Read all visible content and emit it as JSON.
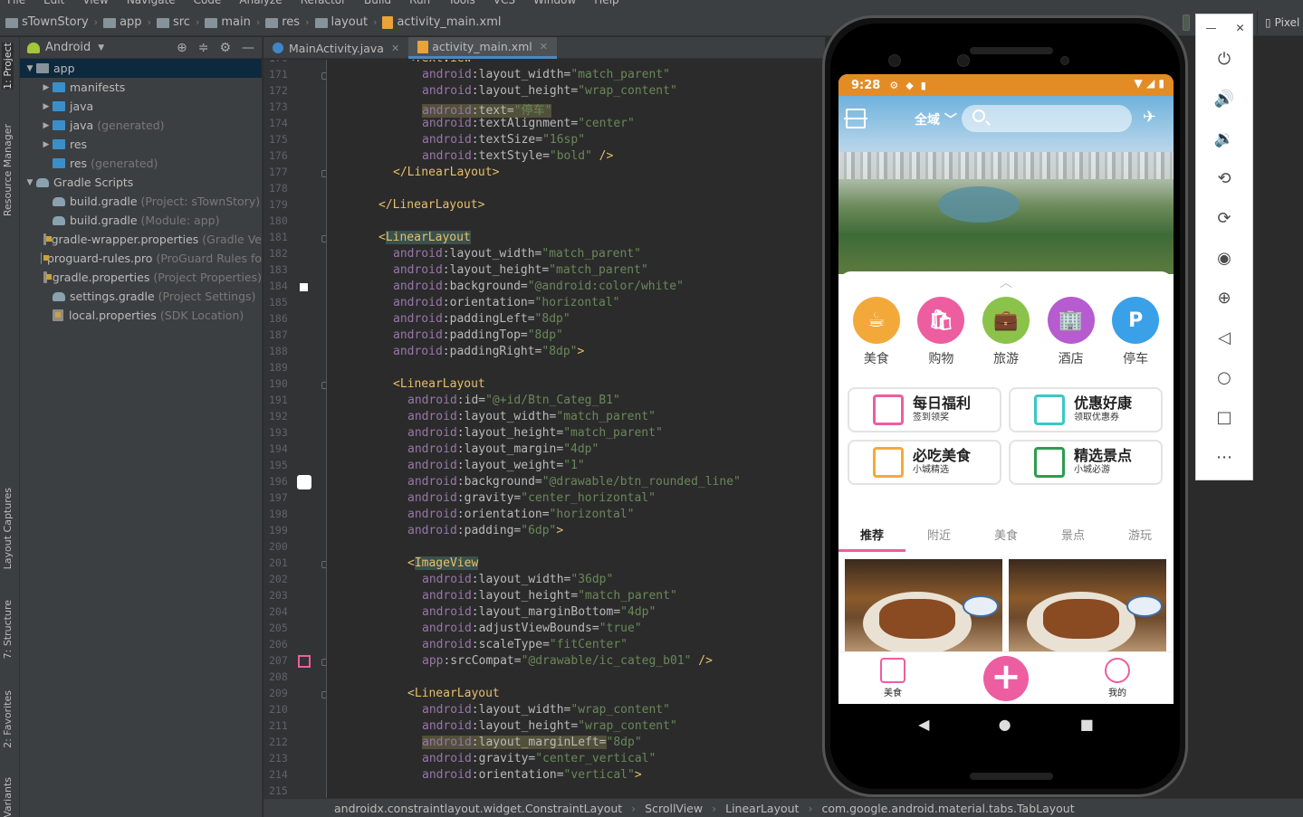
{
  "menu": [
    "File",
    "Edit",
    "View",
    "Navigate",
    "Code",
    "Analyze",
    "Refactor",
    "Build",
    "Run",
    "Tools",
    "VCS",
    "Window",
    "Help"
  ],
  "breadcrumbs": [
    "sTownStory",
    "app",
    "src",
    "main",
    "res",
    "layout",
    "activity_main.xml"
  ],
  "side_tabs": {
    "project": "1: Project",
    "resource_manager": "Resource Manager",
    "layout_captures": "Layout Captures",
    "structure": "7: Structure",
    "favorites": "2: Favorites",
    "variants": "Variants"
  },
  "project_panel": {
    "view_mode": "Android",
    "tree": [
      {
        "label": "app",
        "meta": "",
        "depth": 0,
        "expanded": true,
        "icon": "folder-module-icon",
        "selected": true
      },
      {
        "label": "manifests",
        "meta": "",
        "depth": 1,
        "expanded": false,
        "icon": "folder-icon"
      },
      {
        "label": "java",
        "meta": "",
        "depth": 1,
        "expanded": false,
        "icon": "folder-icon"
      },
      {
        "label": "java",
        "meta": "(generated)",
        "depth": 1,
        "expanded": false,
        "icon": "folder-icon"
      },
      {
        "label": "res",
        "meta": "",
        "depth": 1,
        "expanded": false,
        "icon": "folder-icon"
      },
      {
        "label": "res",
        "meta": "(generated)",
        "depth": 1,
        "expanded": null,
        "icon": "folder-icon"
      },
      {
        "label": "Gradle Scripts",
        "meta": "",
        "depth": 0,
        "expanded": true,
        "icon": "gradle-icon"
      },
      {
        "label": "build.gradle",
        "meta": "(Project: sTownStory)",
        "depth": 1,
        "icon": "gradle-icon"
      },
      {
        "label": "build.gradle",
        "meta": "(Module: app)",
        "depth": 1,
        "icon": "gradle-icon"
      },
      {
        "label": "gradle-wrapper.properties",
        "meta": "(Gradle Ve",
        "depth": 1,
        "icon": "properties-icon"
      },
      {
        "label": "proguard-rules.pro",
        "meta": "(ProGuard Rules fo",
        "depth": 1,
        "icon": "properties-icon"
      },
      {
        "label": "gradle.properties",
        "meta": "(Project Properties)",
        "depth": 1,
        "icon": "properties-icon"
      },
      {
        "label": "settings.gradle",
        "meta": "(Project Settings)",
        "depth": 1,
        "icon": "gradle-icon"
      },
      {
        "label": "local.properties",
        "meta": "(SDK Location)",
        "depth": 1,
        "icon": "properties-icon"
      }
    ]
  },
  "editor_tabs": [
    {
      "label": "MainActivity.java",
      "active": false
    },
    {
      "label": "activity_main.xml",
      "active": true
    }
  ],
  "code": {
    "first_line": 170,
    "lines": [
      {
        "n": 170,
        "indent": 10,
        "tokens": [
          [
            "tg",
            "<TextView"
          ]
        ]
      },
      {
        "n": 171,
        "indent": 12,
        "tokens": [
          [
            "ns",
            "android"
          ],
          [
            "at",
            ":layout_width="
          ],
          [
            "vl",
            "\"match_parent\""
          ]
        ]
      },
      {
        "n": 172,
        "indent": 12,
        "tokens": [
          [
            "ns",
            "android"
          ],
          [
            "at",
            ":layout_height="
          ],
          [
            "vl",
            "\"wrap_content\""
          ]
        ]
      },
      {
        "n": 173,
        "indent": 12,
        "tokens": [
          [
            "hla ns",
            "android"
          ],
          [
            "hla at",
            ":text="
          ],
          [
            "hla vl",
            "\"停车\""
          ]
        ]
      },
      {
        "n": 174,
        "indent": 12,
        "tokens": [
          [
            "ns",
            "android"
          ],
          [
            "at",
            ":textAlignment="
          ],
          [
            "vl",
            "\"center\""
          ]
        ]
      },
      {
        "n": 175,
        "indent": 12,
        "tokens": [
          [
            "ns",
            "android"
          ],
          [
            "at",
            ":textSize="
          ],
          [
            "vl",
            "\"16sp\""
          ]
        ]
      },
      {
        "n": 176,
        "indent": 12,
        "tokens": [
          [
            "ns",
            "android"
          ],
          [
            "at",
            ":textStyle="
          ],
          [
            "vl",
            "\"bold\""
          ],
          [
            "tg",
            " />"
          ]
        ]
      },
      {
        "n": 177,
        "indent": 8,
        "tokens": [
          [
            "tg",
            "</LinearLayout>"
          ]
        ]
      },
      {
        "n": 178,
        "indent": 0,
        "tokens": []
      },
      {
        "n": 179,
        "indent": 6,
        "tokens": [
          [
            "tg",
            "</LinearLayout>"
          ]
        ]
      },
      {
        "n": 180,
        "indent": 0,
        "tokens": []
      },
      {
        "n": 181,
        "indent": 6,
        "tokens": [
          [
            "tg",
            "<"
          ],
          [
            "hl tg",
            "LinearLayout"
          ]
        ]
      },
      {
        "n": 182,
        "indent": 8,
        "tokens": [
          [
            "ns",
            "android"
          ],
          [
            "at",
            ":layout_width="
          ],
          [
            "vl",
            "\"match_parent\""
          ]
        ]
      },
      {
        "n": 183,
        "indent": 8,
        "tokens": [
          [
            "ns",
            "android"
          ],
          [
            "at",
            ":layout_height="
          ],
          [
            "vl",
            "\"match_parent\""
          ]
        ]
      },
      {
        "n": 184,
        "indent": 8,
        "tokens": [
          [
            "ns",
            "android"
          ],
          [
            "at",
            ":background="
          ],
          [
            "vl",
            "\"@android:color/white\""
          ]
        ]
      },
      {
        "n": 185,
        "indent": 8,
        "tokens": [
          [
            "ns",
            "android"
          ],
          [
            "at",
            ":orientation="
          ],
          [
            "vl",
            "\"horizontal\""
          ]
        ]
      },
      {
        "n": 186,
        "indent": 8,
        "tokens": [
          [
            "ns",
            "android"
          ],
          [
            "at",
            ":paddingLeft="
          ],
          [
            "vl",
            "\"8dp\""
          ]
        ]
      },
      {
        "n": 187,
        "indent": 8,
        "tokens": [
          [
            "ns",
            "android"
          ],
          [
            "at",
            ":paddingTop="
          ],
          [
            "vl",
            "\"8dp\""
          ]
        ]
      },
      {
        "n": 188,
        "indent": 8,
        "tokens": [
          [
            "ns",
            "android"
          ],
          [
            "at",
            ":paddingRight="
          ],
          [
            "vl",
            "\"8dp\""
          ],
          [
            "tg",
            ">"
          ]
        ]
      },
      {
        "n": 189,
        "indent": 0,
        "tokens": []
      },
      {
        "n": 190,
        "indent": 8,
        "tokens": [
          [
            "tg",
            "<LinearLayout"
          ]
        ]
      },
      {
        "n": 191,
        "indent": 10,
        "tokens": [
          [
            "ns",
            "android"
          ],
          [
            "at",
            ":id="
          ],
          [
            "vl",
            "\"@+id/Btn_Categ_B1\""
          ]
        ]
      },
      {
        "n": 192,
        "indent": 10,
        "tokens": [
          [
            "ns",
            "android"
          ],
          [
            "at",
            ":layout_width="
          ],
          [
            "vl",
            "\"match_parent\""
          ]
        ]
      },
      {
        "n": 193,
        "indent": 10,
        "tokens": [
          [
            "ns",
            "android"
          ],
          [
            "at",
            ":layout_height="
          ],
          [
            "vl",
            "\"match_parent\""
          ]
        ]
      },
      {
        "n": 194,
        "indent": 10,
        "tokens": [
          [
            "ns",
            "android"
          ],
          [
            "at",
            ":layout_margin="
          ],
          [
            "vl",
            "\"4dp\""
          ]
        ]
      },
      {
        "n": 195,
        "indent": 10,
        "tokens": [
          [
            "ns",
            "android"
          ],
          [
            "at",
            ":layout_weight="
          ],
          [
            "vl",
            "\"1\""
          ]
        ]
      },
      {
        "n": 196,
        "indent": 10,
        "tokens": [
          [
            "ns",
            "android"
          ],
          [
            "at",
            ":background="
          ],
          [
            "vl",
            "\"@drawable/btn_rounded_line\""
          ]
        ]
      },
      {
        "n": 197,
        "indent": 10,
        "tokens": [
          [
            "ns",
            "android"
          ],
          [
            "at",
            ":gravity="
          ],
          [
            "vl",
            "\"center_horizontal\""
          ]
        ]
      },
      {
        "n": 198,
        "indent": 10,
        "tokens": [
          [
            "ns",
            "android"
          ],
          [
            "at",
            ":orientation="
          ],
          [
            "vl",
            "\"horizontal\""
          ]
        ]
      },
      {
        "n": 199,
        "indent": 10,
        "tokens": [
          [
            "ns",
            "android"
          ],
          [
            "at",
            ":padding="
          ],
          [
            "vl",
            "\"6dp\""
          ],
          [
            "tg",
            ">"
          ]
        ]
      },
      {
        "n": 200,
        "indent": 0,
        "tokens": []
      },
      {
        "n": 201,
        "indent": 10,
        "tokens": [
          [
            "tg",
            "<"
          ],
          [
            "hl tg",
            "ImageView"
          ]
        ]
      },
      {
        "n": 202,
        "indent": 12,
        "tokens": [
          [
            "ns",
            "android"
          ],
          [
            "at",
            ":layout_width="
          ],
          [
            "vl",
            "\"36dp\""
          ]
        ]
      },
      {
        "n": 203,
        "indent": 12,
        "tokens": [
          [
            "ns",
            "android"
          ],
          [
            "at",
            ":layout_height="
          ],
          [
            "vl",
            "\"match_parent\""
          ]
        ]
      },
      {
        "n": 204,
        "indent": 12,
        "tokens": [
          [
            "ns",
            "android"
          ],
          [
            "at",
            ":layout_marginBottom="
          ],
          [
            "vl",
            "\"4dp\""
          ]
        ]
      },
      {
        "n": 205,
        "indent": 12,
        "tokens": [
          [
            "ns",
            "android"
          ],
          [
            "at",
            ":adjustViewBounds="
          ],
          [
            "vl",
            "\"true\""
          ]
        ]
      },
      {
        "n": 206,
        "indent": 12,
        "tokens": [
          [
            "ns",
            "android"
          ],
          [
            "at",
            ":scaleType="
          ],
          [
            "vl",
            "\"fitCenter\""
          ]
        ]
      },
      {
        "n": 207,
        "indent": 12,
        "tokens": [
          [
            "ns",
            "app"
          ],
          [
            "at",
            ":srcCompat="
          ],
          [
            "vl",
            "\"@drawable/ic_categ_b01\""
          ],
          [
            "tg",
            " />"
          ]
        ]
      },
      {
        "n": 208,
        "indent": 0,
        "tokens": []
      },
      {
        "n": 209,
        "indent": 10,
        "tokens": [
          [
            "tg",
            "<LinearLayout"
          ]
        ]
      },
      {
        "n": 210,
        "indent": 12,
        "tokens": [
          [
            "ns",
            "android"
          ],
          [
            "at",
            ":layout_width="
          ],
          [
            "vl",
            "\"wrap_content\""
          ]
        ]
      },
      {
        "n": 211,
        "indent": 12,
        "tokens": [
          [
            "ns",
            "android"
          ],
          [
            "at",
            ":layout_height="
          ],
          [
            "vl",
            "\"wrap_content\""
          ]
        ]
      },
      {
        "n": 212,
        "indent": 12,
        "tokens": [
          [
            "hla ns",
            "android"
          ],
          [
            "hla at",
            ":layout_marginLeft="
          ],
          [
            "vl",
            "\"8dp\""
          ]
        ]
      },
      {
        "n": 213,
        "indent": 12,
        "tokens": [
          [
            "ns",
            "android"
          ],
          [
            "at",
            ":gravity="
          ],
          [
            "vl",
            "\"center_vertical\""
          ]
        ]
      },
      {
        "n": 214,
        "indent": 12,
        "tokens": [
          [
            "ns",
            "android"
          ],
          [
            "at",
            ":orientation="
          ],
          [
            "vl",
            "\"vertical\""
          ],
          [
            "tg",
            ">"
          ]
        ]
      },
      {
        "n": 215,
        "indent": 0,
        "tokens": []
      }
    ]
  },
  "status_breadcrumb": [
    "androidx.constraintlayout.widget.ConstraintLayout",
    "ScrollView",
    "LinearLayout",
    "com.google.android.material.tabs.TabLayout"
  ],
  "device_tab": "Pixel",
  "emulator_toolbar": [
    "power-icon",
    "volume-up-icon",
    "volume-down-icon",
    "rotate-left-icon",
    "rotate-right-icon",
    "camera-icon",
    "zoom-icon",
    "back-icon",
    "home-icon",
    "overview-icon",
    "more-icon"
  ],
  "phone": {
    "status_time": "9:28",
    "region": "全域",
    "categories": [
      {
        "label": "美食",
        "color": "#f3a93a"
      },
      {
        "label": "购物",
        "color": "#ec5ea0"
      },
      {
        "label": "旅游",
        "color": "#8bc34a"
      },
      {
        "label": "酒店",
        "color": "#b65cd0"
      },
      {
        "label": "停车",
        "color": "#3aa0e8"
      }
    ],
    "cards": [
      {
        "title": "每日福利",
        "sub": "签到领奖",
        "color": "#ec5ea0"
      },
      {
        "title": "优惠好康",
        "sub": "领取优惠券",
        "color": "#3ac7c9"
      },
      {
        "title": "必吃美食",
        "sub": "小城精选",
        "color": "#f3a93a"
      },
      {
        "title": "精选景点",
        "sub": "小城必游",
        "color": "#2e9b4e"
      }
    ],
    "tabs": [
      "推荐",
      "附近",
      "美食",
      "景点",
      "游玩"
    ],
    "active_tab": "推荐",
    "bottom_nav": {
      "left": "美食",
      "right": "我的"
    },
    "accent": "#ec5ea0",
    "status_color": "#e38c26"
  }
}
